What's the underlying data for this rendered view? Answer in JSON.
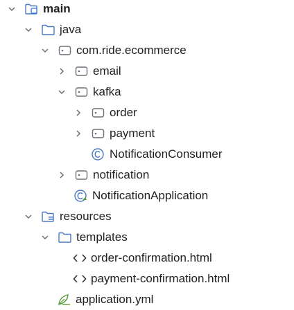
{
  "tree": {
    "main": "main",
    "java": "java",
    "package": "com.ride.ecommerce",
    "email": "email",
    "kafka": "kafka",
    "order": "order",
    "payment": "payment",
    "notification_consumer": "NotificationConsumer",
    "notification": "notification",
    "notification_application": "NotificationApplication",
    "resources": "resources",
    "templates": "templates",
    "order_confirmation": "order-confirmation.html",
    "payment_confirmation": "payment-confirmation.html",
    "application_yml": "application.yml"
  },
  "colors": {
    "text": "#1f1f1f",
    "chevron": "#6e6e6e",
    "folder_icon": "#4a78c2",
    "package_icon": "#6b6f76",
    "source_accent": "#3574f0",
    "resources_accent": "#4a78c2",
    "html_icon": "#333333",
    "yml_icon": "#5a9a3c"
  }
}
